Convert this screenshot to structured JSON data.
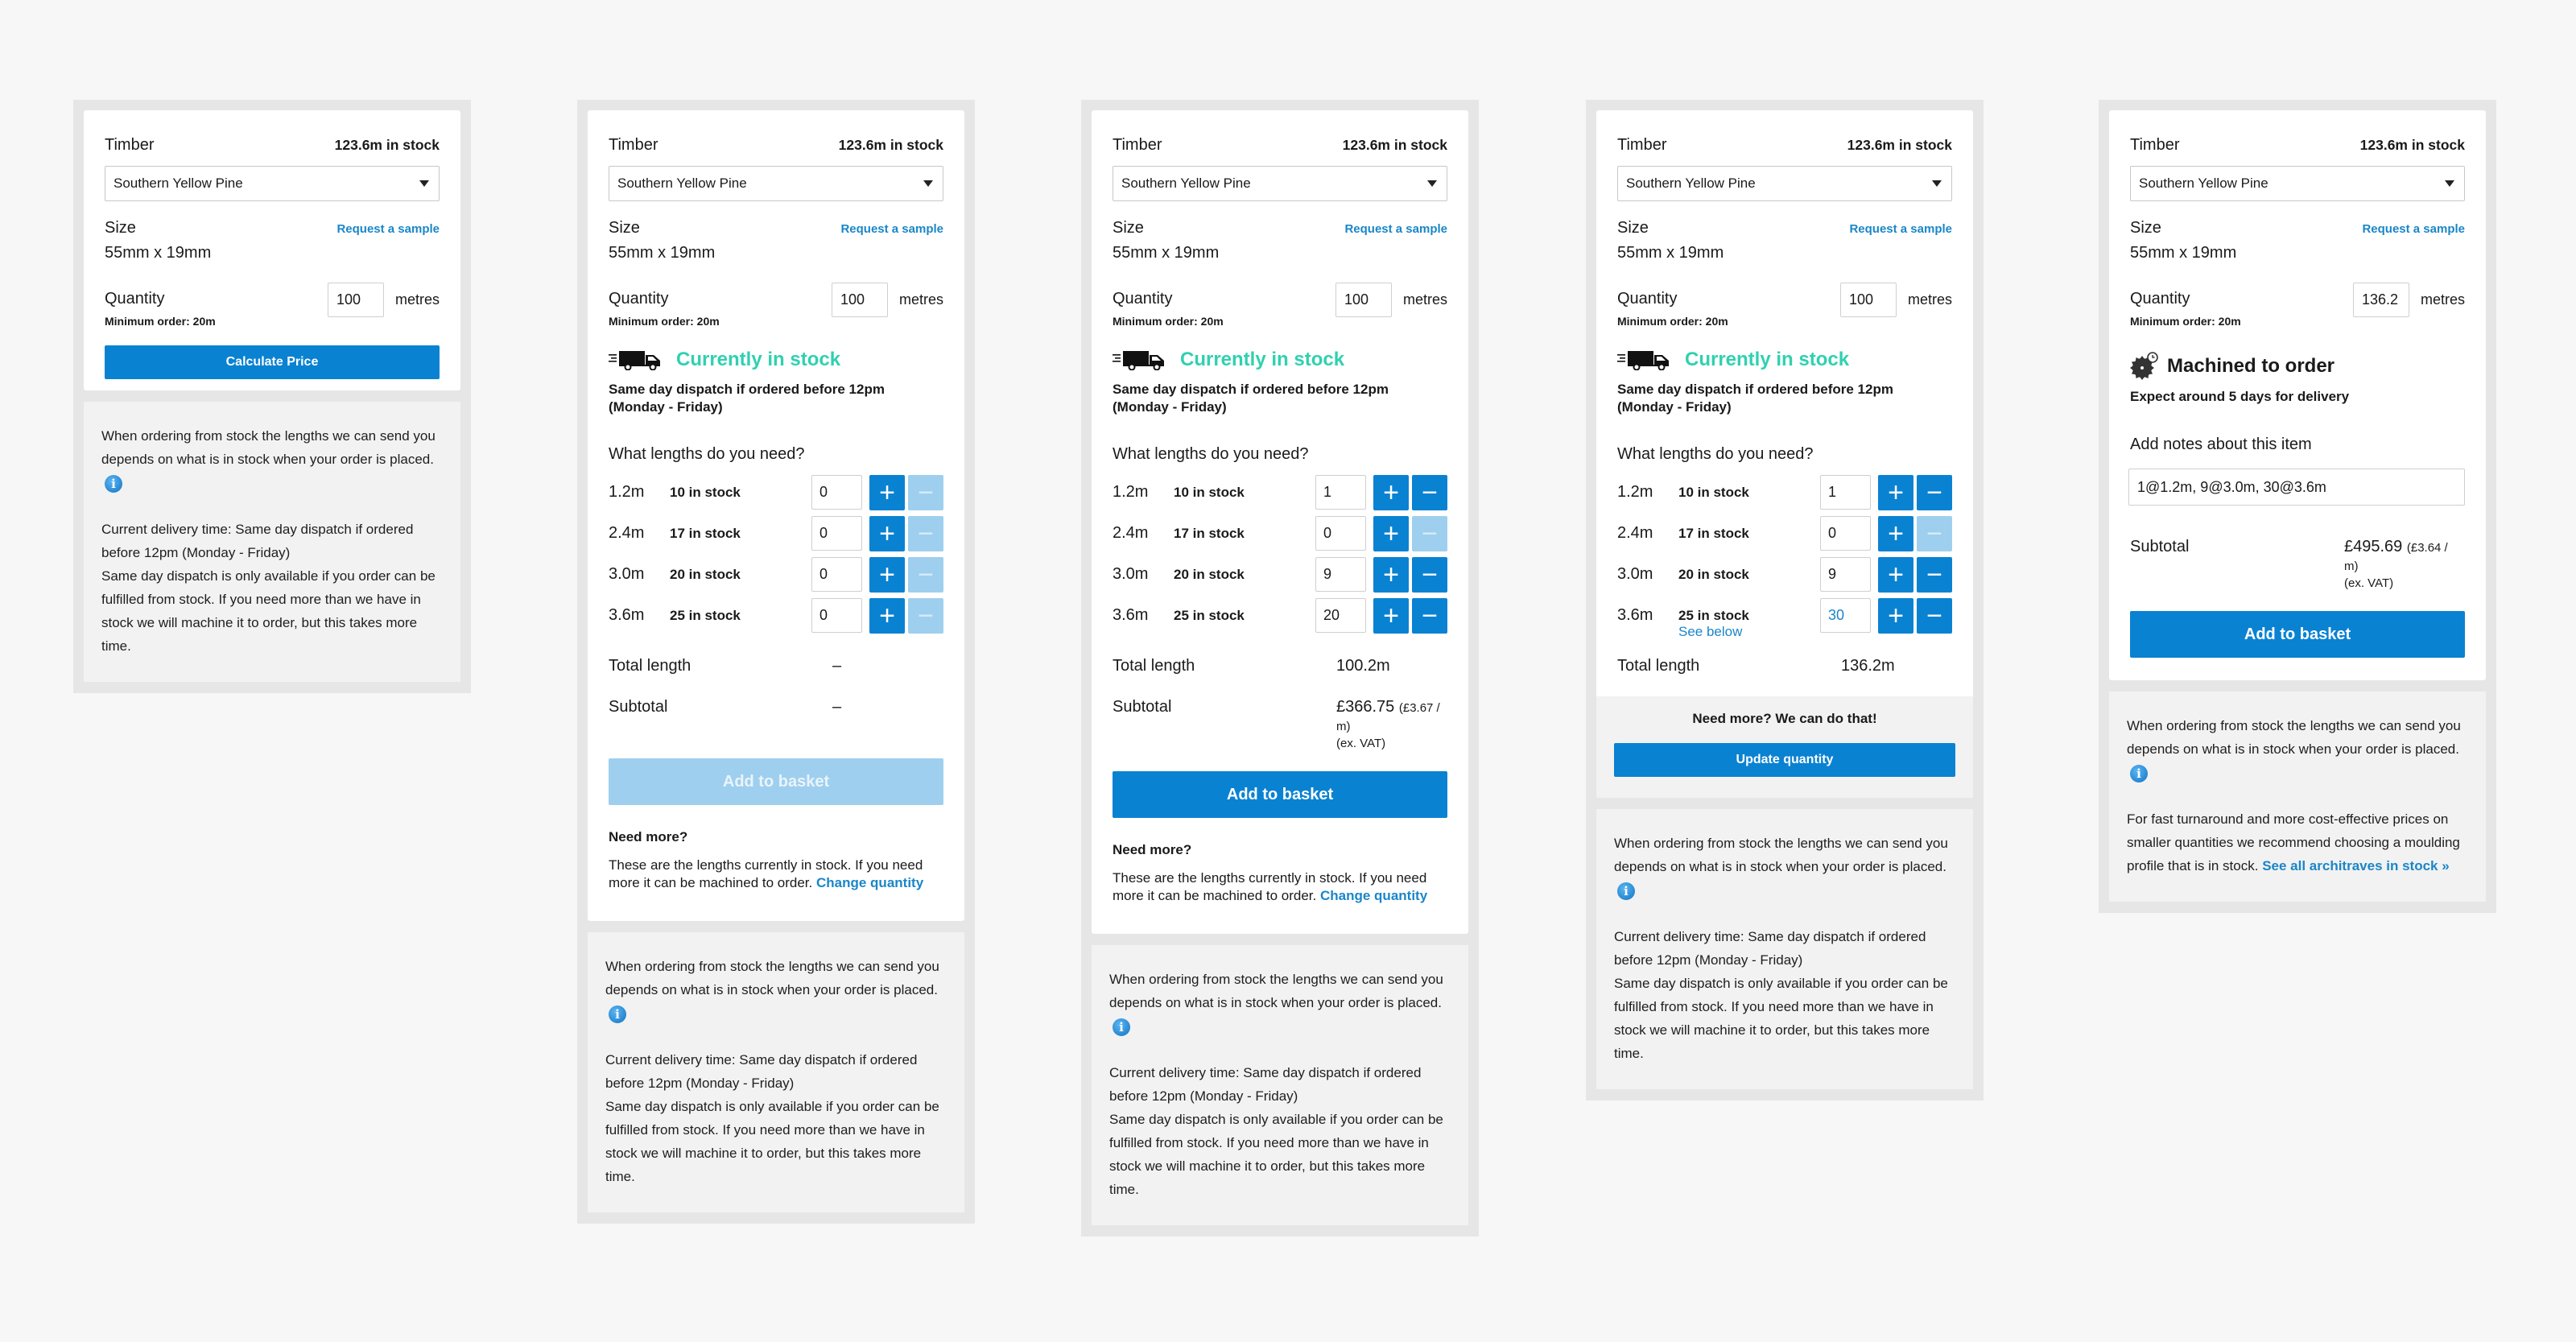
{
  "common": {
    "timber_label": "Timber",
    "timber_stock": "123.6m in stock",
    "timber_selected": "Southern Yellow Pine",
    "size_label": "Size",
    "request_sample": "Request a sample",
    "size_value": "55mm x 19mm",
    "quantity_label": "Quantity",
    "minimum_order": "Minimum order: 20m",
    "metres_label": "metres",
    "stock_title": "Currently in stock",
    "dispatch_text": "Same day dispatch if ordered before 12pm (Monday - Friday)",
    "lengths_question": "What lengths do you need?",
    "total_length_label": "Total length",
    "subtotal_label": "Subtotal",
    "ex_vat": "(ex. VAT)",
    "add_to_basket": "Add to basket",
    "need_more_heading": "Need more?",
    "need_more_text": "These are the lengths currently in stock. If you need more it can be machined to order.",
    "change_quantity": "Change quantity",
    "info_para1": "When ordering from stock the lengths we can send you depends on what is in stock when your order is placed.",
    "info_para2a": "Current delivery time: Same day dispatch if ordered before 12pm (Monday - Friday)",
    "info_para2b": "Same day dispatch is only available if you order can be fulfilled from stock. If you need more than we have in stock we will machine it to order, but this takes more time.",
    "plus": "+",
    "minus": "−",
    "colors": {
      "primary": "#0a82d2",
      "disabled": "#9fcfee",
      "in_stock": "#2fd1b0",
      "link": "#1a86c8"
    }
  },
  "panel1": {
    "quantity": "100",
    "calculate_price": "Calculate Price"
  },
  "panel2": {
    "quantity": "100",
    "lengths": [
      {
        "length": "1.2m",
        "stock": "10 in stock",
        "qty": "0"
      },
      {
        "length": "2.4m",
        "stock": "17 in stock",
        "qty": "0"
      },
      {
        "length": "3.0m",
        "stock": "20 in stock",
        "qty": "0"
      },
      {
        "length": "3.6m",
        "stock": "25 in stock",
        "qty": "0"
      }
    ],
    "total_length": "–",
    "subtotal": "–"
  },
  "panel3": {
    "quantity": "100",
    "lengths": [
      {
        "length": "1.2m",
        "stock": "10 in stock",
        "qty": "1"
      },
      {
        "length": "2.4m",
        "stock": "17 in stock",
        "qty": "0"
      },
      {
        "length": "3.0m",
        "stock": "20 in stock",
        "qty": "9"
      },
      {
        "length": "3.6m",
        "stock": "25 in stock",
        "qty": "20"
      }
    ],
    "total_length": "100.2m",
    "subtotal": "£366.75",
    "per_metre": "(£3.67 / m)"
  },
  "panel4": {
    "quantity": "100",
    "lengths": [
      {
        "length": "1.2m",
        "stock": "10 in stock",
        "qty": "1"
      },
      {
        "length": "2.4m",
        "stock": "17 in stock",
        "qty": "0"
      },
      {
        "length": "3.0m",
        "stock": "20 in stock",
        "qty": "9"
      },
      {
        "length": "3.6m",
        "stock": "25 in stock",
        "qty": "30",
        "note": "See below"
      }
    ],
    "total_length": "136.2m",
    "upsell_heading": "Need more? We can do that!",
    "update_quantity": "Update quantity"
  },
  "panel5": {
    "quantity": "136.2",
    "machined_title": "Machined to order",
    "expect_delivery": "Expect around 5 days for delivery",
    "notes_label": "Add notes about this item",
    "notes_value": "1@1.2m, 9@3.0m, 30@3.6m",
    "subtotal": "£495.69",
    "per_metre": "(£3.64 / m)",
    "info_para2": "For fast turnaround and more cost-effective prices on smaller quantities we recommend choosing a moulding profile that is in stock.",
    "see_all_link": "See all architraves in stock »"
  }
}
